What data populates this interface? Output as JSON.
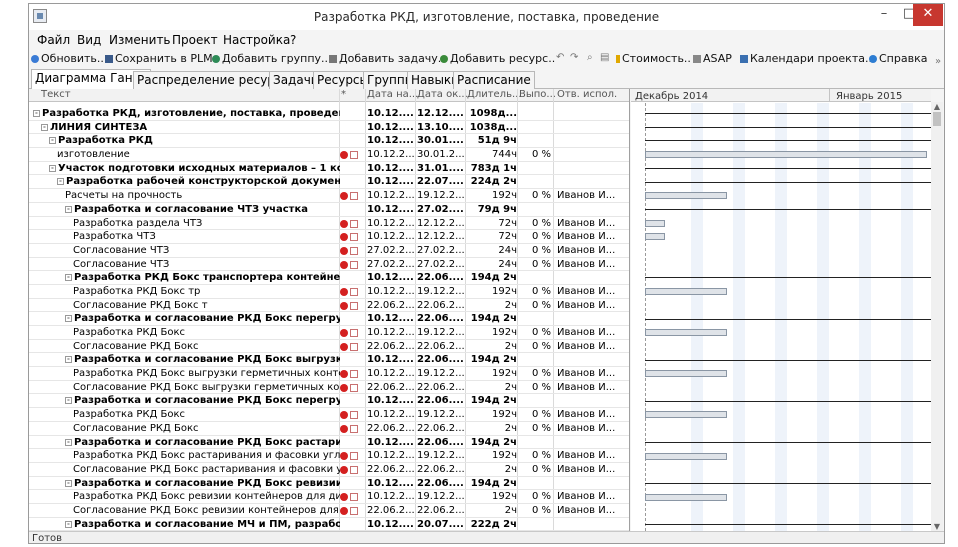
{
  "window": {
    "title": "Разработка РКД, изготовление, поставка, проведение",
    "min_glyph": "–",
    "max_glyph": "□",
    "close_glyph": "✕"
  },
  "menu": [
    "Файл",
    "Вид",
    "Изменить",
    "Проект",
    "Настройка",
    "?"
  ],
  "toolbar": {
    "refresh": "Обновить..",
    "save_plm": "Сохранить в PLM",
    "add_group": "Добавить группу..",
    "add_task": "Добавить задачу..",
    "add_resource": "Добавить ресурс..",
    "binoculars": "⌕",
    "cost": "Стоимость..",
    "asap": "ASAP",
    "calendars": "Календари проекта..",
    "help": "Справка"
  },
  "tabs": [
    "Диаграмма Ганта",
    "Распределение ресурсов",
    "Задачи",
    "Ресурсы",
    "Группы",
    "Навыки",
    "Расписание"
  ],
  "columns": {
    "name": "Текст",
    "ind": "*",
    "start": "Дата на...",
    "end": "Дата ок...",
    "duration": "Длитель...",
    "percent": "Выпо...",
    "resource": "Отв. испол."
  },
  "gantt": {
    "months": [
      "Декабрь 2014",
      "Январь 2015"
    ]
  },
  "rows": [
    {
      "indent": 0,
      "bold": true,
      "exp": "-",
      "name": "Разработка РКД, изготовление, поставка, проведение",
      "ind": false,
      "start": "10.12....",
      "end": "12.12....",
      "dur": "1098д...",
      "pct": "",
      "res": "",
      "g": "line"
    },
    {
      "indent": 1,
      "bold": true,
      "exp": "-",
      "name": "ЛИНИЯ СИНТЕЗА",
      "ind": false,
      "start": "10.12....",
      "end": "13.10....",
      "dur": "1038д...",
      "pct": "",
      "res": "",
      "g": "line"
    },
    {
      "indent": 2,
      "bold": true,
      "exp": "-",
      "name": "Разработка РКД",
      "ind": false,
      "start": "10.12....",
      "end": "30.01....",
      "dur": "51д 9ч",
      "pct": "",
      "res": "",
      "g": "line"
    },
    {
      "indent": 3,
      "bold": false,
      "exp": "",
      "name": "изготовление",
      "ind": true,
      "start": "10.12.2...",
      "end": "30.01.2...",
      "dur": "744ч",
      "pct": "0 %",
      "res": "",
      "g": "bar",
      "w": 282
    },
    {
      "indent": 2,
      "bold": true,
      "exp": "-",
      "name": "Участок   подготовки исходных материалов – 1 ко...",
      "ind": false,
      "start": "10.12....",
      "end": "31.01....",
      "dur": "783д 1ч",
      "pct": "",
      "res": "",
      "g": "line"
    },
    {
      "indent": 3,
      "bold": true,
      "exp": "-",
      "name": "Разработка  рабочей конструкторской документа...",
      "ind": false,
      "start": "10.12....",
      "end": "22.07....",
      "dur": "224д 2ч",
      "pct": "",
      "res": "",
      "g": "line"
    },
    {
      "indent": 4,
      "bold": false,
      "exp": "",
      "name": "Расчеты на прочность",
      "ind": true,
      "start": "10.12.2...",
      "end": "19.12.2...",
      "dur": "192ч",
      "pct": "0 %",
      "res": "Иванов И...",
      "g": "bar",
      "w": 82
    },
    {
      "indent": 4,
      "bold": true,
      "exp": "-",
      "name": "Разработка и согласование ЧТЗ участка",
      "ind": false,
      "start": "10.12....",
      "end": "27.02....",
      "dur": "79д 9ч",
      "pct": "",
      "res": "",
      "g": "line"
    },
    {
      "indent": 5,
      "bold": false,
      "exp": "",
      "name": "Разработка раздела ЧТЗ",
      "ind": true,
      "start": "10.12.2...",
      "end": "12.12.2...",
      "dur": "72ч",
      "pct": "0 %",
      "res": "Иванов И...",
      "g": "bar",
      "w": 20
    },
    {
      "indent": 5,
      "bold": false,
      "exp": "",
      "name": "Разработка ЧТЗ",
      "ind": true,
      "start": "10.12.2...",
      "end": "12.12.2...",
      "dur": "72ч",
      "pct": "0 %",
      "res": "Иванов И...",
      "g": "bar",
      "w": 20
    },
    {
      "indent": 5,
      "bold": false,
      "exp": "",
      "name": "Согласование ЧТЗ",
      "ind": true,
      "start": "27.02.2...",
      "end": "27.02.2...",
      "dur": "24ч",
      "pct": "0 %",
      "res": "Иванов И...",
      "g": "none"
    },
    {
      "indent": 5,
      "bold": false,
      "exp": "",
      "name": "Согласование ЧТЗ",
      "ind": true,
      "start": "27.02.2...",
      "end": "27.02.2...",
      "dur": "24ч",
      "pct": "0 %",
      "res": "Иванов И...",
      "g": "none"
    },
    {
      "indent": 4,
      "bold": true,
      "exp": "-",
      "name": "Разработка   РКД Бокс транспортера контейнер...",
      "ind": false,
      "start": "10.12....",
      "end": "22.06....",
      "dur": "194д 2ч",
      "pct": "",
      "res": "",
      "g": "line"
    },
    {
      "indent": 5,
      "bold": false,
      "exp": "",
      "name": "Разработка  РКД Бокс тр",
      "ind": true,
      "start": "10.12.2...",
      "end": "19.12.2...",
      "dur": "192ч",
      "pct": "0 %",
      "res": "Иванов И...",
      "g": "bar",
      "w": 82
    },
    {
      "indent": 5,
      "bold": false,
      "exp": "",
      "name": "Согласование РКД Бокс т",
      "ind": true,
      "start": "22.06.2...",
      "end": "22.06.2...",
      "dur": "2ч",
      "pct": "0 %",
      "res": "Иванов И...",
      "g": "none"
    },
    {
      "indent": 4,
      "bold": true,
      "exp": "-",
      "name": "Разработка и согласование   РКД Бокс перегруз...",
      "ind": false,
      "start": "10.12....",
      "end": "22.06....",
      "dur": "194д 2ч",
      "pct": "",
      "res": "",
      "g": "line"
    },
    {
      "indent": 5,
      "bold": false,
      "exp": "",
      "name": "Разработка РКД Бокс",
      "ind": true,
      "start": "10.12.2...",
      "end": "19.12.2...",
      "dur": "192ч",
      "pct": "0 %",
      "res": "Иванов И...",
      "g": "bar",
      "w": 82
    },
    {
      "indent": 5,
      "bold": false,
      "exp": "",
      "name": "Согласование РКД Бокс",
      "ind": true,
      "start": "22.06.2...",
      "end": "22.06.2...",
      "dur": "2ч",
      "pct": "0 %",
      "res": "Иванов И...",
      "g": "none"
    },
    {
      "indent": 4,
      "bold": true,
      "exp": "-",
      "name": "Разработка и согласование РКД Бокс выгрузки...",
      "ind": false,
      "start": "10.12....",
      "end": "22.06....",
      "dur": "194д 2ч",
      "pct": "",
      "res": "",
      "g": "line"
    },
    {
      "indent": 5,
      "bold": false,
      "exp": "",
      "name": "Разработка РКД Бокс выгрузки герметичных контейн...",
      "ind": true,
      "start": "10.12.2...",
      "end": "19.12.2...",
      "dur": "192ч",
      "pct": "0 %",
      "res": "Иванов И...",
      "g": "bar",
      "w": 82
    },
    {
      "indent": 5,
      "bold": false,
      "exp": "",
      "name": "Согласование РКД Бокс выгрузки герметичных конте...",
      "ind": true,
      "start": "22.06.2...",
      "end": "22.06.2...",
      "dur": "2ч",
      "pct": "0 %",
      "res": "Иванов И...",
      "g": "none"
    },
    {
      "indent": 4,
      "bold": true,
      "exp": "-",
      "name": "Разработка и согласование РКД Бокс перегрузк...",
      "ind": false,
      "start": "10.12....",
      "end": "22.06....",
      "dur": "194д 2ч",
      "pct": "",
      "res": "",
      "g": "line"
    },
    {
      "indent": 5,
      "bold": false,
      "exp": "",
      "name": "Разработка РКД Бокс",
      "ind": true,
      "start": "10.12.2...",
      "end": "19.12.2...",
      "dur": "192ч",
      "pct": "0 %",
      "res": "Иванов И...",
      "g": "bar",
      "w": 82
    },
    {
      "indent": 5,
      "bold": false,
      "exp": "",
      "name": "Согласование РКД Бокс",
      "ind": true,
      "start": "22.06.2...",
      "end": "22.06.2...",
      "dur": "2ч",
      "pct": "0 %",
      "res": "Иванов И...",
      "g": "none"
    },
    {
      "indent": 4,
      "bold": true,
      "exp": "-",
      "name": "Разработка и согласование РКД Бокс растарива...",
      "ind": false,
      "start": "10.12....",
      "end": "22.06....",
      "dur": "194д 2ч",
      "pct": "",
      "res": "",
      "g": "line"
    },
    {
      "indent": 5,
      "bold": false,
      "exp": "",
      "name": "Разработка РКД Бокс растаривания и фасовки углеро...",
      "ind": true,
      "start": "10.12.2...",
      "end": "19.12.2...",
      "dur": "192ч",
      "pct": "0 %",
      "res": "Иванов И...",
      "g": "bar",
      "w": 82
    },
    {
      "indent": 5,
      "bold": false,
      "exp": "",
      "name": "Согласование  РКД Бокс растаривания и фасовки угл...",
      "ind": true,
      "start": "22.06.2...",
      "end": "22.06.2...",
      "dur": "2ч",
      "pct": "0 %",
      "res": "Иванов И...",
      "g": "none"
    },
    {
      "indent": 4,
      "bold": true,
      "exp": "-",
      "name": "Разработка и согласование РКД Бокс ревизии к...",
      "ind": false,
      "start": "10.12....",
      "end": "22.06....",
      "dur": "194д 2ч",
      "pct": "",
      "res": "",
      "g": "line"
    },
    {
      "indent": 5,
      "bold": false,
      "exp": "",
      "name": "Разработка РКД Бокс ревизии контейнеров для диокс...",
      "ind": true,
      "start": "10.12.2...",
      "end": "19.12.2...",
      "dur": "192ч",
      "pct": "0 %",
      "res": "Иванов И...",
      "g": "bar",
      "w": 82
    },
    {
      "indent": 5,
      "bold": false,
      "exp": "",
      "name": "Согласование РКД Бокс ревизии контейнеров для дио...",
      "ind": true,
      "start": "22.06.2...",
      "end": "22.06.2...",
      "dur": "2ч",
      "pct": "0 %",
      "res": "Иванов И...",
      "g": "none"
    },
    {
      "indent": 4,
      "bold": true,
      "exp": "-",
      "name": "Разработка и согласование МЧ и ПМ, разработк...",
      "ind": false,
      "start": "10.12....",
      "end": "20.07....",
      "dur": "222д 2ч",
      "pct": "",
      "res": "",
      "g": "line"
    }
  ],
  "status": "Готов"
}
